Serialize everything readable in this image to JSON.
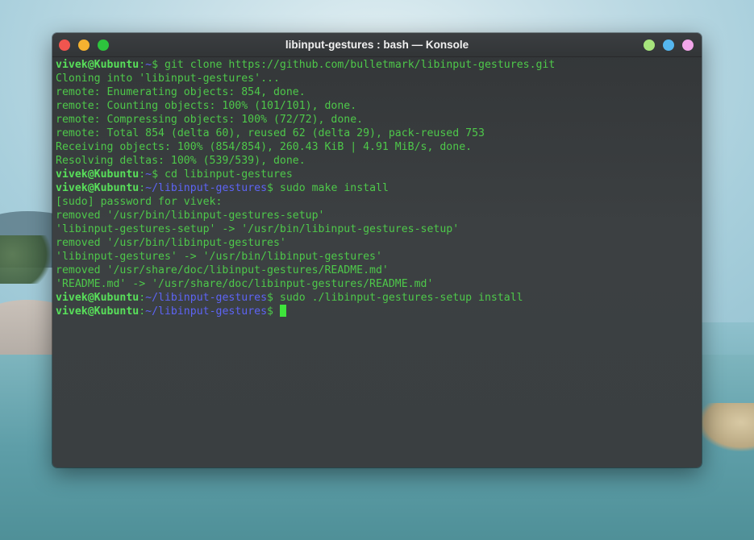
{
  "window": {
    "title": "libinput-gestures : bash — Konsole"
  },
  "terminal": {
    "lines": [
      {
        "type": "prompt",
        "user": "vivek@Kubuntu",
        "sep": ":",
        "path": "~",
        "sym": "$ ",
        "cmd": "git clone https://github.com/bulletmark/libinput-gestures.git"
      },
      {
        "type": "out",
        "text": "Cloning into 'libinput-gestures'..."
      },
      {
        "type": "out",
        "text": "remote: Enumerating objects: 854, done."
      },
      {
        "type": "out",
        "text": "remote: Counting objects: 100% (101/101), done."
      },
      {
        "type": "out",
        "text": "remote: Compressing objects: 100% (72/72), done."
      },
      {
        "type": "out",
        "text": "remote: Total 854 (delta 60), reused 62 (delta 29), pack-reused 753"
      },
      {
        "type": "out",
        "text": "Receiving objects: 100% (854/854), 260.43 KiB | 4.91 MiB/s, done."
      },
      {
        "type": "out",
        "text": "Resolving deltas: 100% (539/539), done."
      },
      {
        "type": "prompt",
        "user": "vivek@Kubuntu",
        "sep": ":",
        "path": "~",
        "sym": "$ ",
        "cmd": "cd libinput-gestures"
      },
      {
        "type": "prompt",
        "user": "vivek@Kubuntu",
        "sep": ":",
        "path": "~/libinput-gestures",
        "sym": "$ ",
        "cmd": "sudo make install"
      },
      {
        "type": "out",
        "text": "[sudo] password for vivek:"
      },
      {
        "type": "out",
        "text": "removed '/usr/bin/libinput-gestures-setup'"
      },
      {
        "type": "out",
        "text": "'libinput-gestures-setup' -> '/usr/bin/libinput-gestures-setup'"
      },
      {
        "type": "out",
        "text": "removed '/usr/bin/libinput-gestures'"
      },
      {
        "type": "out",
        "text": "'libinput-gestures' -> '/usr/bin/libinput-gestures'"
      },
      {
        "type": "out",
        "text": "removed '/usr/share/doc/libinput-gestures/README.md'"
      },
      {
        "type": "out",
        "text": "'README.md' -> '/usr/share/doc/libinput-gestures/README.md'"
      },
      {
        "type": "prompt",
        "user": "vivek@Kubuntu",
        "sep": ":",
        "path": "~/libinput-gestures",
        "sym": "$ ",
        "cmd": "sudo ./libinput-gestures-setup install"
      },
      {
        "type": "prompt",
        "user": "vivek@Kubuntu",
        "sep": ":",
        "path": "~/libinput-gestures",
        "sym": "$ ",
        "cmd": "",
        "cursor": true
      }
    ]
  },
  "colors": {
    "output": "#4ec84a",
    "user": "#58e05a",
    "path": "#5d64f5",
    "cursor": "#3ee43b",
    "close": "#f0554f",
    "minimize": "#f5b230",
    "maximize": "#2dc43d"
  }
}
